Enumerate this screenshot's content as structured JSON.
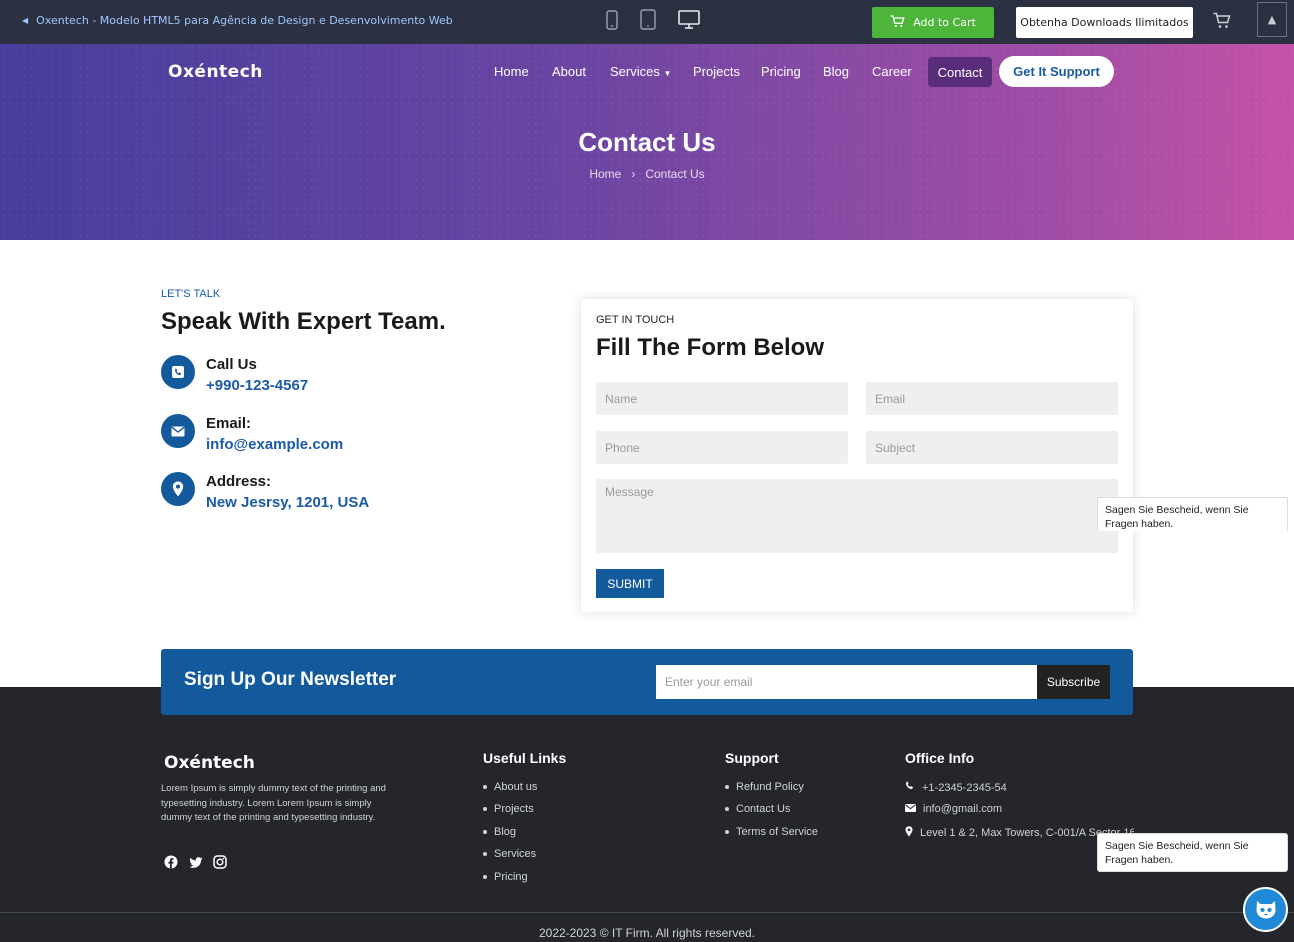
{
  "topbar": {
    "back_text": "Oxentech - Modelo HTML5 para Agência de Design e Desenvolvimento Web",
    "add_to_cart": "Add to Cart",
    "downloads": "Obtenha Downloads Ilimitados"
  },
  "header": {
    "logo": "Oxéntech",
    "nav": [
      "Home",
      "About",
      "Services",
      "Projects",
      "Pricing",
      "Blog",
      "Career"
    ],
    "active_nav": "Contact",
    "cta": "Get It Support"
  },
  "hero": {
    "title": "Contact Us",
    "breadcrumb_home": "Home",
    "breadcrumb_sep": "›",
    "breadcrumb_current": "Contact Us"
  },
  "contact": {
    "eyebrow": "LET'S TALK",
    "title": "Speak With Expert Team.",
    "items": [
      {
        "label": "Call Us",
        "value": "+990-123-4567"
      },
      {
        "label": "Email:",
        "value": "info@example.com"
      },
      {
        "label": "Address:",
        "value": "New Jesrsy, 1201, USA"
      }
    ]
  },
  "form": {
    "eyebrow": "GET IN TOUCH",
    "title": "Fill The Form Below",
    "name_placeholder": "Name",
    "email_placeholder": "Email",
    "phone_placeholder": "Phone",
    "subject_placeholder": "Subject",
    "message_placeholder": "Message",
    "submit": "SUBMIT"
  },
  "tooltip": {
    "text_line1": "Sagen Sie Bescheid, wenn Sie",
    "text_line2": "Fragen haben."
  },
  "newsletter": {
    "title": "Sign Up Our Newsletter",
    "placeholder": "Enter your email",
    "button": "Subscribe"
  },
  "footer": {
    "logo": "Oxéntech",
    "description": "Lorem Ipsum is simply dummy text of the printing and typesetting industry. Lorem Lorem Ipsum is simply dummy text of the printing and typesetting industry.",
    "useful_title": "Useful Links",
    "useful_links": [
      "About us",
      "Projects",
      "Blog",
      "Services",
      "Pricing"
    ],
    "support_title": "Support",
    "support_links": [
      "Refund Policy",
      "Contact Us",
      "Terms of Service"
    ],
    "office_title": "Office Info",
    "phone": "+1-2345-2345-54",
    "email": "info@gmail.com",
    "address": "Level 1 & 2, Max Towers, C-001/A Sector 16 B",
    "copyright": "2022-2023 © IT Firm. All rights reserved."
  }
}
